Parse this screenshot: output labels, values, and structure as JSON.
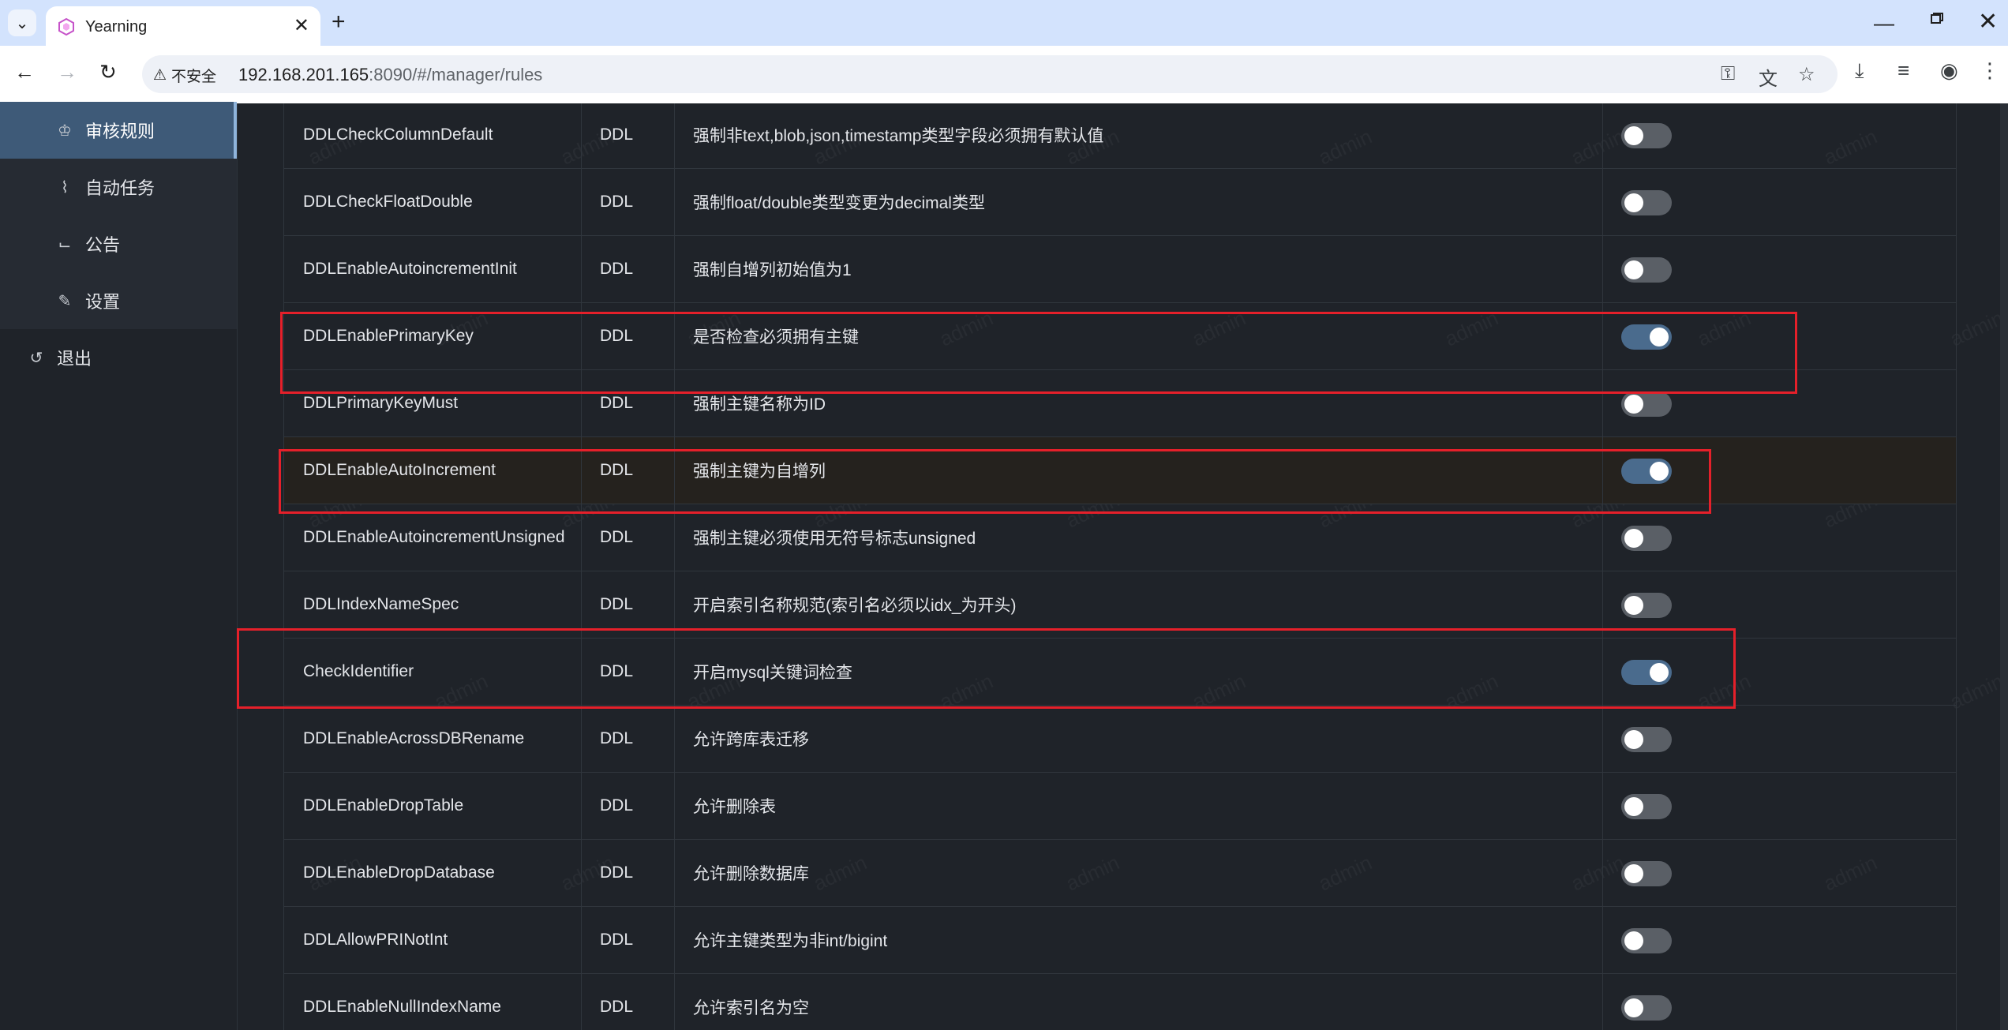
{
  "browser": {
    "tab_title": "Yearning",
    "tab_close": "✕",
    "new_tab": "+",
    "security_label": "不安全",
    "url_host": "192.168.201.165",
    "url_rest": ":8090/#/manager/rules"
  },
  "sidebar": {
    "items": [
      {
        "label": "审核规则",
        "icon": "crown-icon",
        "active": true
      },
      {
        "label": "自动任务",
        "icon": "paperclip-icon",
        "active": false
      },
      {
        "label": "公告",
        "icon": "chart-icon",
        "active": false
      },
      {
        "label": "设置",
        "icon": "wrench-icon",
        "active": false
      }
    ],
    "logout_label": "退出"
  },
  "rules": [
    {
      "name": "DDLCheckColumnDefault",
      "type": "DDL",
      "desc": "强制非text,blob,json,timestamp类型字段必须拥有默认值",
      "enabled": false
    },
    {
      "name": "DDLCheckFloatDouble",
      "type": "DDL",
      "desc": "强制float/double类型变更为decimal类型",
      "enabled": false
    },
    {
      "name": "DDLEnableAutoincrementInit",
      "type": "DDL",
      "desc": "强制自增列初始值为1",
      "enabled": false
    },
    {
      "name": "DDLEnablePrimaryKey",
      "type": "DDL",
      "desc": "是否检查必须拥有主键",
      "enabled": true
    },
    {
      "name": "DDLPrimaryKeyMust",
      "type": "DDL",
      "desc": "强制主键名称为ID",
      "enabled": false
    },
    {
      "name": "DDLEnableAutoIncrement",
      "type": "DDL",
      "desc": "强制主键为自增列",
      "enabled": true
    },
    {
      "name": "DDLEnableAutoincrementUnsigned",
      "type": "DDL",
      "desc": "强制主键必须使用无符号标志unsigned",
      "enabled": false
    },
    {
      "name": "DDLIndexNameSpec",
      "type": "DDL",
      "desc": "开启索引名称规范(索引名必须以idx_为开头)",
      "enabled": false
    },
    {
      "name": "CheckIdentifier",
      "type": "DDL",
      "desc": "开启mysql关键词检查",
      "enabled": true
    },
    {
      "name": "DDLEnableAcrossDBRename",
      "type": "DDL",
      "desc": "允许跨库表迁移",
      "enabled": false
    },
    {
      "name": "DDLEnableDropTable",
      "type": "DDL",
      "desc": "允许删除表",
      "enabled": false
    },
    {
      "name": "DDLEnableDropDatabase",
      "type": "DDL",
      "desc": "允许删除数据库",
      "enabled": false
    },
    {
      "name": "DDLAllowPRINotInt",
      "type": "DDL",
      "desc": "允许主键类型为非int/bigint",
      "enabled": false
    },
    {
      "name": "DDLEnableNullIndexName",
      "type": "DDL",
      "desc": "允许索引名为空",
      "enabled": false
    }
  ],
  "watermark": "admin",
  "colors": {
    "accent": "#4a6b8d",
    "annotation": "#e5202a",
    "background": "#1f2329"
  }
}
